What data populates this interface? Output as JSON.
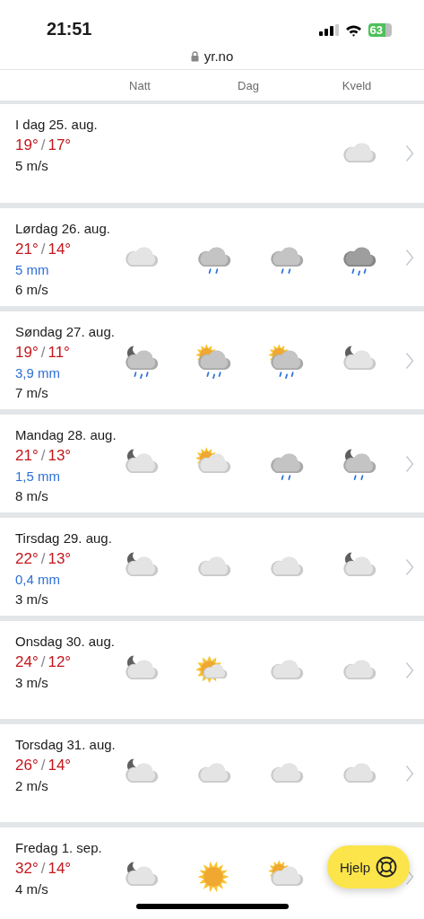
{
  "status_bar": {
    "time": "21:51",
    "battery": "63"
  },
  "url_bar": {
    "domain": "yr.no"
  },
  "columns": [
    "Natt",
    "Dag",
    "Kveld"
  ],
  "days": [
    {
      "date": "I dag 25. aug.",
      "high": "19°",
      "slash": "/",
      "low": "17°",
      "wind": "5 m/s",
      "icons": [
        {
          "kind": "empty"
        },
        {
          "kind": "empty"
        },
        {
          "kind": "empty"
        },
        {
          "kind": "cloudy"
        }
      ]
    },
    {
      "date": "Lørdag 26. aug.",
      "high": "21°",
      "slash": "/",
      "low": "14°",
      "precipitation": "5 mm",
      "wind": "6 m/s",
      "icons": [
        {
          "kind": "cloudy"
        },
        {
          "kind": "rain"
        },
        {
          "kind": "rain"
        },
        {
          "kind": "heavy-rain"
        }
      ]
    },
    {
      "date": "Søndag 27. aug.",
      "high": "19°",
      "slash": "/",
      "low": "11°",
      "precipitation": "3,9 mm",
      "wind": "7 m/s",
      "icons": [
        {
          "kind": "night-rain"
        },
        {
          "kind": "sun-rain"
        },
        {
          "kind": "sun-rain"
        },
        {
          "kind": "night-cloudy"
        }
      ]
    },
    {
      "date": "Mandag 28. aug.",
      "high": "21°",
      "slash": "/",
      "low": "13°",
      "precipitation": "1,5 mm",
      "wind": "8 m/s",
      "icons": [
        {
          "kind": "night-cloudy"
        },
        {
          "kind": "sun-cloudy"
        },
        {
          "kind": "rain"
        },
        {
          "kind": "night-light-rain"
        }
      ]
    },
    {
      "date": "Tirsdag 29. aug.",
      "high": "22°",
      "slash": "/",
      "low": "13°",
      "precipitation": "0,4 mm",
      "wind": "3 m/s",
      "icons": [
        {
          "kind": "night-cloudy"
        },
        {
          "kind": "cloudy"
        },
        {
          "kind": "cloudy"
        },
        {
          "kind": "night-cloudy"
        }
      ]
    },
    {
      "date": "Onsdag 30. aug.",
      "high": "24°",
      "slash": "/",
      "low": "12°",
      "wind": "3 m/s",
      "icons": [
        {
          "kind": "night-cloudy"
        },
        {
          "kind": "sun-small-cloud"
        },
        {
          "kind": "cloudy"
        },
        {
          "kind": "cloudy"
        }
      ]
    },
    {
      "date": "Torsdag 31. aug.",
      "high": "26°",
      "slash": "/",
      "low": "14°",
      "wind": "2 m/s",
      "icons": [
        {
          "kind": "night-cloudy"
        },
        {
          "kind": "cloudy"
        },
        {
          "kind": "cloudy"
        },
        {
          "kind": "cloudy"
        }
      ]
    },
    {
      "date": "Fredag 1. sep.",
      "high": "32°",
      "slash": "/",
      "low": "14°",
      "wind": "4 m/s",
      "icons": [
        {
          "kind": "night-cloudy"
        },
        {
          "kind": "clear-sun"
        },
        {
          "kind": "sun-cloudy"
        },
        {
          "kind": "empty"
        }
      ]
    }
  ],
  "help_button": {
    "label": "Hjelp"
  }
}
